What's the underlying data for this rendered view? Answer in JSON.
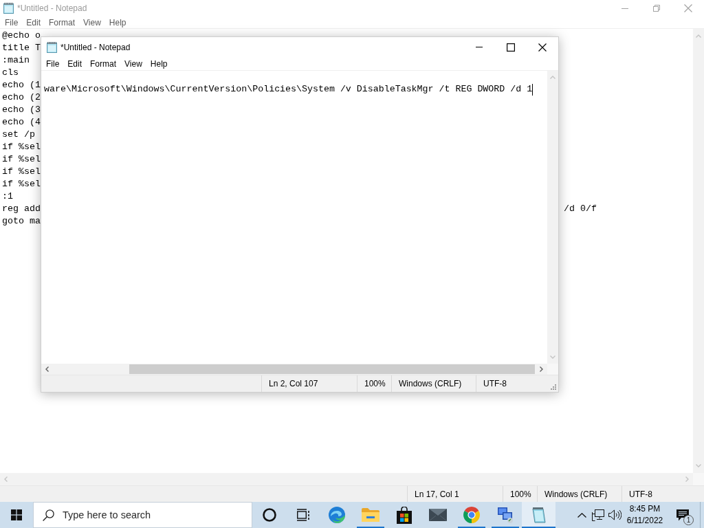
{
  "windows": [
    {
      "title": "*Untitled - Notepad",
      "active": false,
      "maximized": true,
      "menu": [
        "File",
        "Edit",
        "Format",
        "View",
        "Help"
      ],
      "lines": [
        [
          "@echo o"
        ],
        [
          "title T"
        ],
        [
          ":main"
        ],
        [
          "cls"
        ],
        [
          "echo (1"
        ],
        [
          "echo (2"
        ],
        [
          "echo (3"
        ],
        [
          "echo (4"
        ],
        [
          "set /p"
        ],
        [
          "if %sel"
        ],
        [
          "if %sel"
        ],
        [
          "if %sel"
        ],
        [
          "if %sel"
        ],
        [
          ":1"
        ],
        [
          "reg add",
          "/d 0/f"
        ],
        [
          "goto ma"
        ]
      ],
      "status_bar": [
        "Ln 17, Col 1",
        "100%",
        "Windows (CRLF)",
        "UTF-8"
      ]
    },
    {
      "title": "*Untitled - Notepad",
      "active": true,
      "maximized": false,
      "menu": [
        "File",
        "Edit",
        "Format",
        "View",
        "Help"
      ],
      "lines": [
        [
          "ware\\Microsoft\\Windows\\CurrentVersion\\Policies\\System /v DisableTaskMgr /t REG DWORD /d 1"
        ]
      ],
      "status_bar": [
        "Ln 2, Col 107",
        "100%",
        "Windows (CRLF)",
        "UTF-8"
      ]
    }
  ],
  "taskbar": {
    "search": {
      "placeholder": "Type here to search"
    },
    "buttons": [
      {
        "kind": "ring",
        "running": false,
        "selected": false
      },
      {
        "kind": "taskview",
        "running": false,
        "selected": false
      },
      {
        "kind": "swirl",
        "running": false,
        "selected": false
      },
      {
        "kind": "folder",
        "running": true,
        "selected": false
      },
      {
        "kind": "bag",
        "running": false,
        "selected": false
      },
      {
        "kind": "envelope",
        "running": false,
        "selected": false
      },
      {
        "kind": "wheel",
        "running": true,
        "selected": false
      },
      {
        "kind": "monitors",
        "running": true,
        "selected": false
      },
      {
        "kind": "notepad",
        "running": true,
        "selected": true
      }
    ],
    "clock": {
      "time": "8:45 PM",
      "date": "6/11/2022"
    },
    "notifications": {
      "count": "1"
    }
  }
}
